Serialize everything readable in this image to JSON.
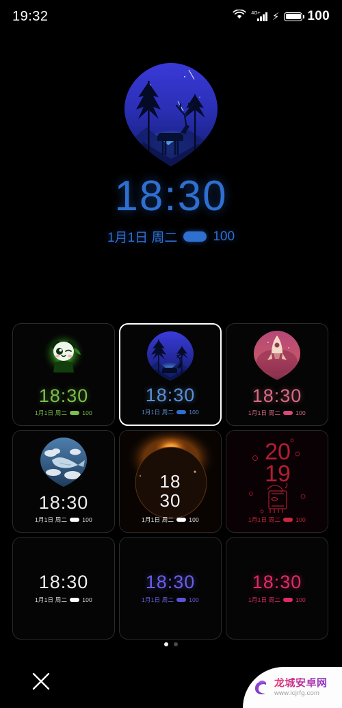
{
  "status_bar": {
    "time": "19:32",
    "network_label": "4G+",
    "battery_percent": "100",
    "icons": [
      "wifi-icon",
      "signal-bars-icon",
      "charging-bolt-icon",
      "battery-icon"
    ]
  },
  "preview": {
    "art": "deer-forest-night-scene",
    "time": "18:30",
    "date": "1月1日 周二",
    "battery_percent": "100",
    "accent_color": "#2f6fd0"
  },
  "grid": {
    "tiles": [
      {
        "id": "panda",
        "art": "panda-green-icon",
        "time": "18:30",
        "date": "1月1日 周二",
        "battery": "100",
        "color": "#7bbf4a",
        "selected": false
      },
      {
        "id": "deer",
        "art": "deer-forest-night-icon",
        "time": "18:30",
        "date": "1月1日 周二",
        "battery": "100",
        "color": "#5b8fd6",
        "selected": true
      },
      {
        "id": "rocket",
        "art": "rocket-pink-icon",
        "time": "18:30",
        "date": "1月1日 周二",
        "battery": "100",
        "color": "#d86b86",
        "selected": false
      },
      {
        "id": "whale",
        "art": "whale-clouds-icon",
        "time": "18:30",
        "date": "1月1日 周二",
        "battery": "100",
        "color": "#e8e8e8",
        "selected": false
      },
      {
        "id": "eclipse",
        "art": "eclipse-planet-icon",
        "time": "18\n30",
        "time_line1": "18",
        "time_line2": "30",
        "date": "1月1日 周二",
        "battery": "100",
        "color": "#f2f2f2",
        "selected": false
      },
      {
        "id": "newyear",
        "art": "chinese-new-year-pig-icon",
        "time_line1": "20",
        "time_line2": "19",
        "date": "1月1日 周二",
        "battery": "100",
        "color": "#c9283e",
        "selected": false
      },
      {
        "id": "plain-white",
        "art": "none",
        "time": "18:30",
        "date": "1月1日 周二",
        "battery": "100",
        "color": "#ededed",
        "selected": false
      },
      {
        "id": "plain-purple",
        "art": "none",
        "time": "18:30",
        "date": "1月1日 周二",
        "battery": "100",
        "color": "#5b52d8",
        "selected": false
      },
      {
        "id": "plain-pink",
        "art": "none",
        "time": "18:30",
        "date": "1月1日 周二",
        "battery": "100",
        "color": "#e02a66",
        "selected": false
      }
    ]
  },
  "pagination": {
    "total": 2,
    "active_index": 0
  },
  "bottom_bar": {
    "close_label": "✕",
    "apply_label": ""
  },
  "watermark": {
    "title": "龙城安卓网",
    "url": "www.lcjrfg.com",
    "logo": "dragon-c-logo"
  }
}
